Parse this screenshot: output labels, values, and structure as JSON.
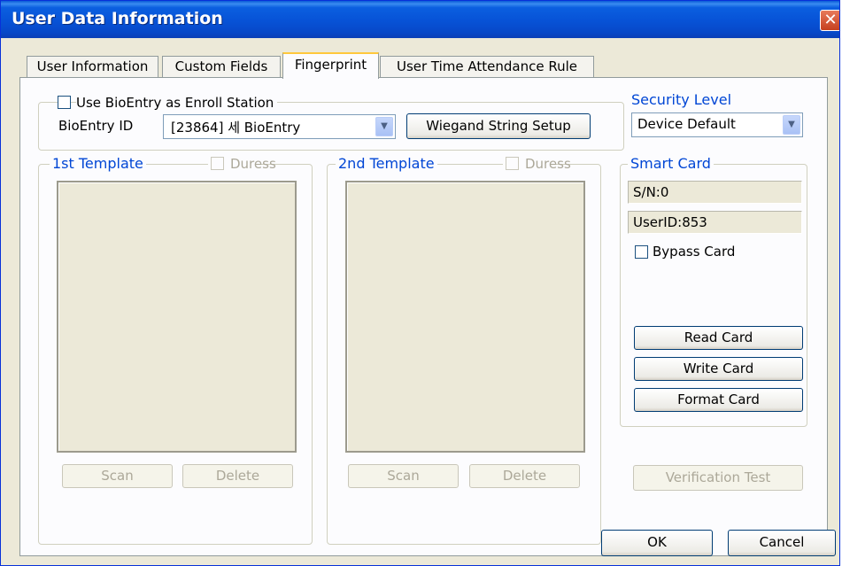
{
  "window": {
    "title": "User Data Information"
  },
  "tabs": [
    {
      "label": "User Information"
    },
    {
      "label": "Custom Fields"
    },
    {
      "label": "Fingerprint"
    },
    {
      "label": "User Time Attendance Rule"
    }
  ],
  "enroll": {
    "use_bioentry_label": "Use BioEntry as Enroll Station",
    "bioentry_id_label": "BioEntry ID",
    "bioentry_id_value": "[23864] 세 BioEntry",
    "wiegand_button": "Wiegand String Setup"
  },
  "security": {
    "title": "Security Level",
    "value": "Device Default"
  },
  "template1": {
    "title": "1st Template",
    "duress_label": "Duress",
    "scan_button": "Scan",
    "delete_button": "Delete"
  },
  "template2": {
    "title": "2nd Template",
    "duress_label": "Duress",
    "scan_button": "Scan",
    "delete_button": "Delete"
  },
  "smart_card": {
    "title": "Smart Card",
    "sn": "S/N:0",
    "user_id": "UserID:853",
    "bypass_label": "Bypass Card",
    "read_button": "Read Card",
    "write_button": "Write Card",
    "format_button": "Format Card"
  },
  "verification_button": "Verification Test",
  "footer": {
    "ok_button": "OK",
    "cancel_button": "Cancel"
  }
}
